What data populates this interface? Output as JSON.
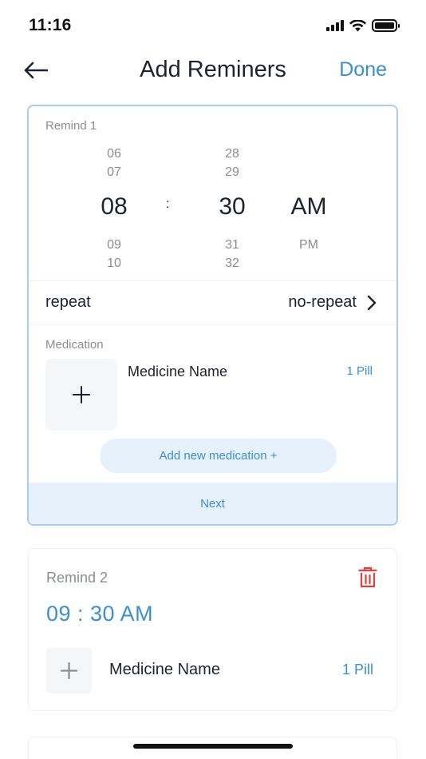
{
  "status_bar": {
    "time": "11:16"
  },
  "nav": {
    "title": "Add Reminers",
    "done_label": "Done"
  },
  "remind_1": {
    "label": "Remind 1",
    "hour": {
      "above": [
        "06",
        "07"
      ],
      "selected": "08",
      "below": [
        "09",
        "10"
      ]
    },
    "separator": ":",
    "minute": {
      "above": [
        "28",
        "29"
      ],
      "selected": "30",
      "below": [
        "31",
        "32"
      ]
    },
    "period": {
      "selected": "AM",
      "below": [
        "PM"
      ]
    },
    "repeat": {
      "label": "repeat",
      "value": "no-repeat"
    },
    "medication": {
      "section_label": "Medication",
      "name": "Medicine Name",
      "dose": "1 Pill"
    },
    "add_medication_label": "Add new medication +",
    "next_label": "Next"
  },
  "remind_2": {
    "label": "Remind 2",
    "time": "09 : 30 AM",
    "medication": {
      "name": "Medicine Name",
      "dose": "1 Pill"
    }
  },
  "colors": {
    "accent": "#3a8fd6",
    "accent_light": "#e6f1fb",
    "danger": "#e5403c",
    "border_active": "#a8cdf0"
  },
  "icons": [
    "back-arrow-icon",
    "chevron-right-icon",
    "plus-icon",
    "trash-icon",
    "signal-icon",
    "wifi-icon",
    "battery-icon"
  ]
}
